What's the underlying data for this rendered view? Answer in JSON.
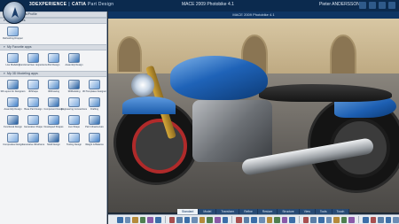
{
  "app": {
    "brand": "3DEXPERIENCE",
    "product": "CATIA",
    "product_suffix": "Part Design",
    "document_title": "MACE 2009 Photobike 4.1",
    "user": "Pieter ANDERSSON"
  },
  "left_panel": {
    "sections": [
      {
        "title": "Moola Bulldes/Profile",
        "tiles": []
      },
      {
        "title": "My Favorites",
        "tiles": [
          {
            "label": "Refreshing Dropper",
            "icon": "refresh-icon"
          }
        ]
      },
      {
        "title": "My Favorite apps",
        "tiles": [
          {
            "label": "Live Modeling",
            "icon": "live-modeling-icon"
          },
          {
            "label": "Functional Gen. Experience",
            "icon": "functional-icon"
          },
          {
            "label": "Part Design",
            "icon": "part-design-icon"
          },
          {
            "label": "Assembly Design",
            "icon": "assembly-icon"
          }
        ]
      },
      {
        "title": "My 3D Modeling apps",
        "tiles": [
          {
            "label": "3D Layout for Designers",
            "icon": "layout-icon"
          },
          {
            "label": "3DShape",
            "icon": "shape-icon"
          },
          {
            "label": "3DDrawing",
            "icon": "drawing-icon"
          },
          {
            "label": "3DModeling",
            "icon": "modeling-icon"
          },
          {
            "label": "3D Templates Designer",
            "icon": "templates-icon"
          },
          {
            "label": "Assembly Design",
            "icon": "assembly-icon"
          },
          {
            "label": "Base Part Design",
            "icon": "base-part-icon"
          },
          {
            "label": "Component Design",
            "icon": "component-icon"
          },
          {
            "label": "Engineering Connections",
            "icon": "connections-icon"
          },
          {
            "label": "Drafting",
            "icon": "drafting-icon"
          },
          {
            "label": "Functional Design",
            "icon": "functional-design-icon"
          },
          {
            "label": "Generative Shape",
            "icon": "generative-icon"
          },
          {
            "label": "Developed Shapes",
            "icon": "developed-icon"
          },
          {
            "label": "Live Shape",
            "icon": "live-shape-icon"
          },
          {
            "label": "Part Infrastructure",
            "icon": "infrastructure-icon"
          },
          {
            "label": "Composites Design",
            "icon": "composites-icon"
          },
          {
            "label": "Generative Wireframe",
            "icon": "wireframe-icon"
          },
          {
            "label": "Mold Design",
            "icon": "mold-icon"
          },
          {
            "label": "Tooling Design",
            "icon": "tooling-icon"
          },
          {
            "label": "Weight & Balance",
            "icon": "weight-icon"
          }
        ]
      }
    ]
  },
  "tabs": [
    "Standard",
    "Model",
    "Transform",
    "Refine",
    "Restore",
    "Structure",
    "View",
    "Tools",
    "Touch"
  ],
  "colors": {
    "topbar": "#0b2a4e",
    "accent_blue": "#1f63b8",
    "panel_bg": "#f3f4f6",
    "toolbar_bg": "#e7ebf0"
  }
}
